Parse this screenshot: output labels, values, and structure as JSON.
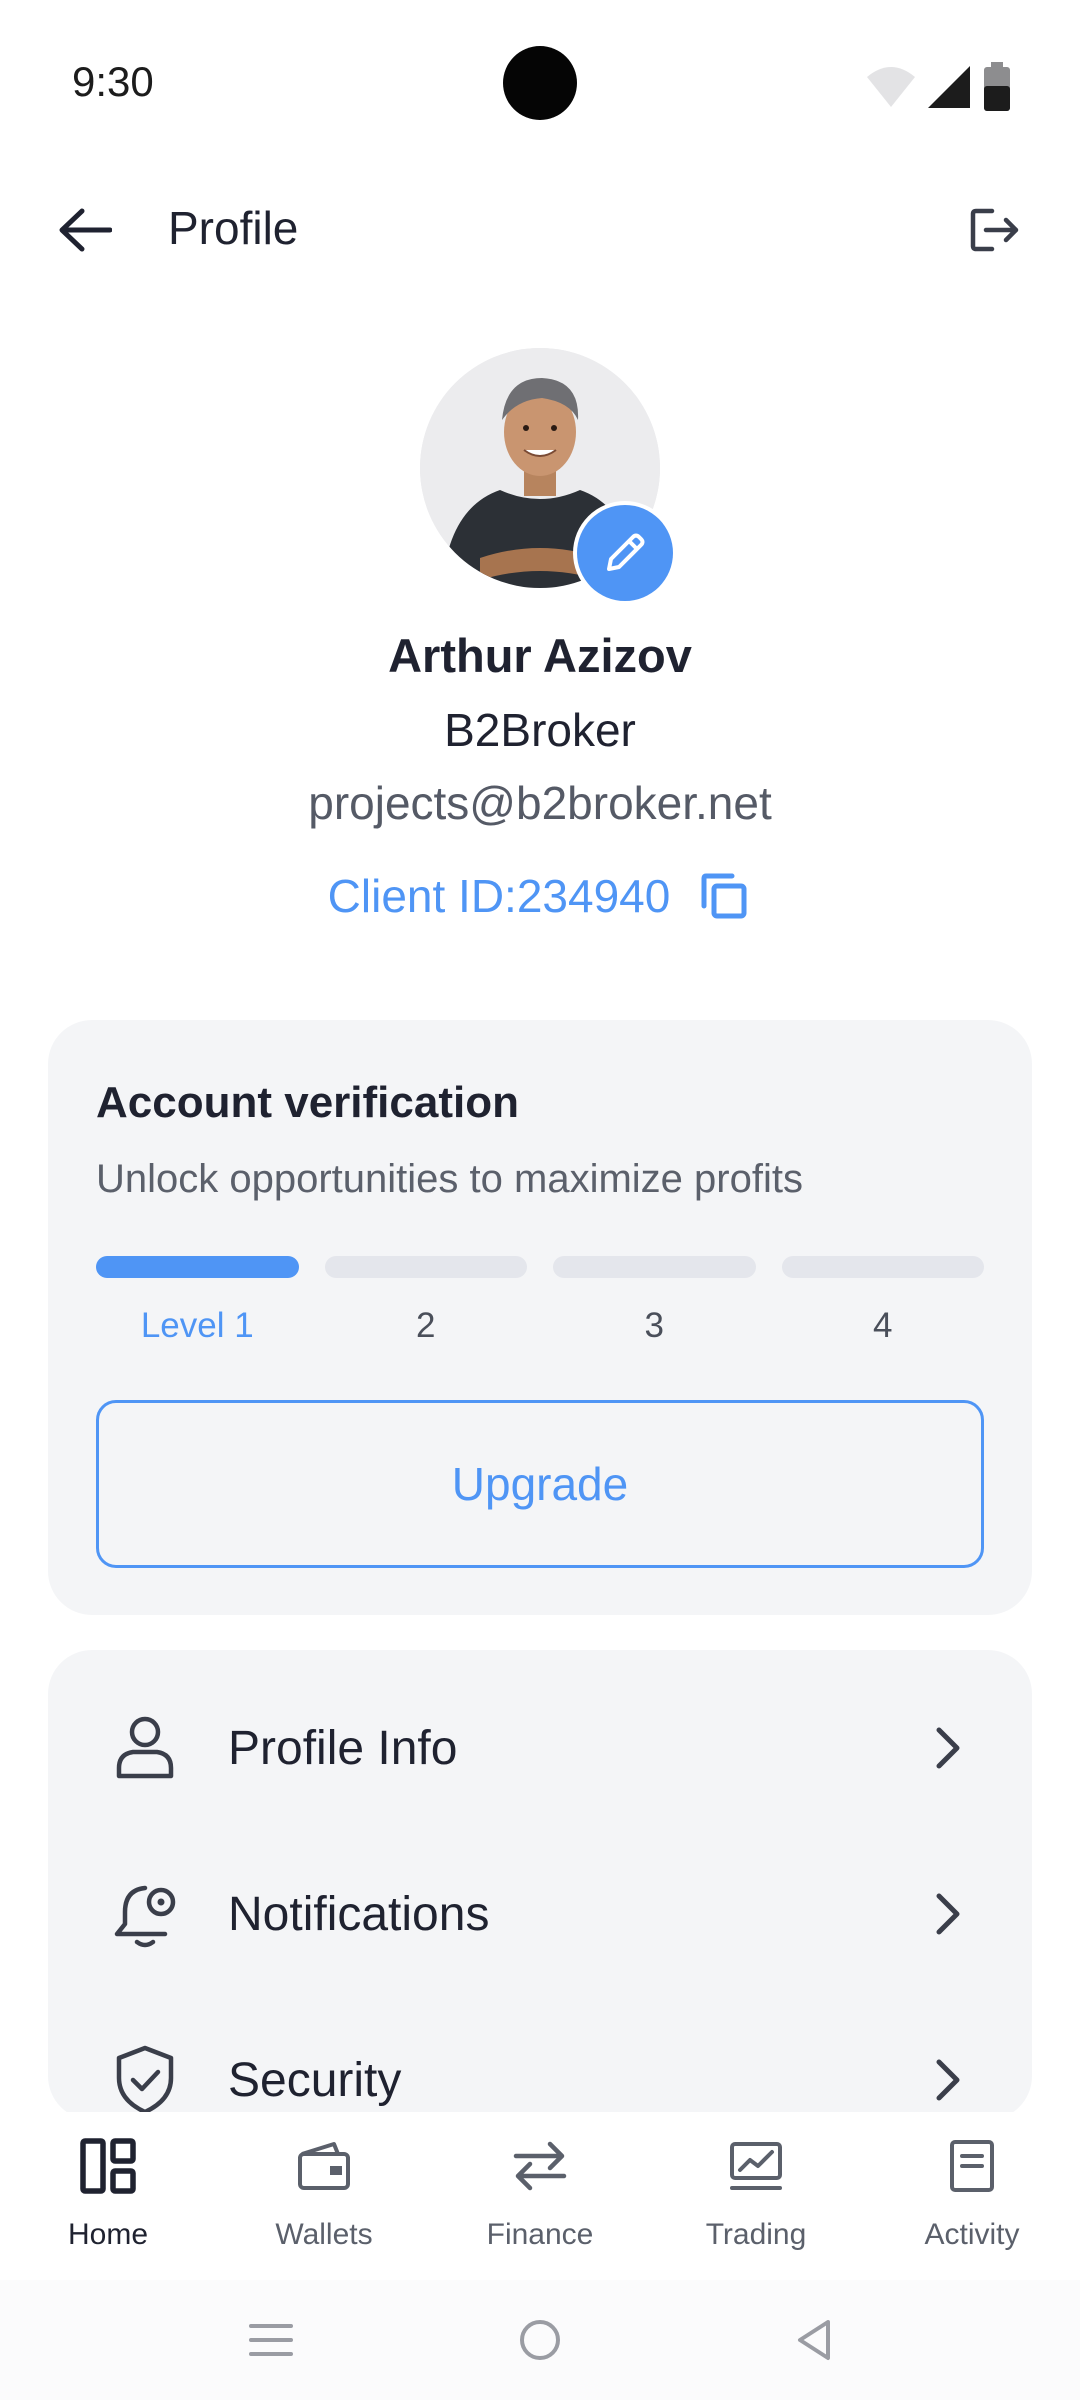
{
  "status_bar": {
    "time": "9:30"
  },
  "app_bar": {
    "title": "Profile"
  },
  "profile": {
    "name": "Arthur Azizov",
    "company": "B2Broker",
    "email": "projects@b2broker.net",
    "client_id": "Client ID:234940"
  },
  "verification": {
    "title": "Account verification",
    "subtitle": "Unlock opportunities to maximize profits",
    "levels": [
      "Level 1",
      "2",
      "3",
      "4"
    ],
    "current_level": 1,
    "upgrade_label": "Upgrade"
  },
  "menu": {
    "items": [
      {
        "label": "Profile Info",
        "icon": "user-icon"
      },
      {
        "label": "Notifications",
        "icon": "bell-gear-icon"
      },
      {
        "label": "Security",
        "icon": "shield-check-icon"
      }
    ]
  },
  "bottom_nav": {
    "active": "Home",
    "items": [
      {
        "label": "Home",
        "icon": "dashboard-icon"
      },
      {
        "label": "Wallets",
        "icon": "wallet-icon"
      },
      {
        "label": "Finance",
        "icon": "transfer-arrows-icon"
      },
      {
        "label": "Trading",
        "icon": "chart-monitor-icon"
      },
      {
        "label": "Activity",
        "icon": "document-icon"
      }
    ]
  },
  "colors": {
    "accent": "#4f95f5",
    "card_background": "#f4f5f7",
    "text_primary": "#1f2230",
    "text_secondary": "#5b606b",
    "level_inactive": "#e4e6ec"
  }
}
